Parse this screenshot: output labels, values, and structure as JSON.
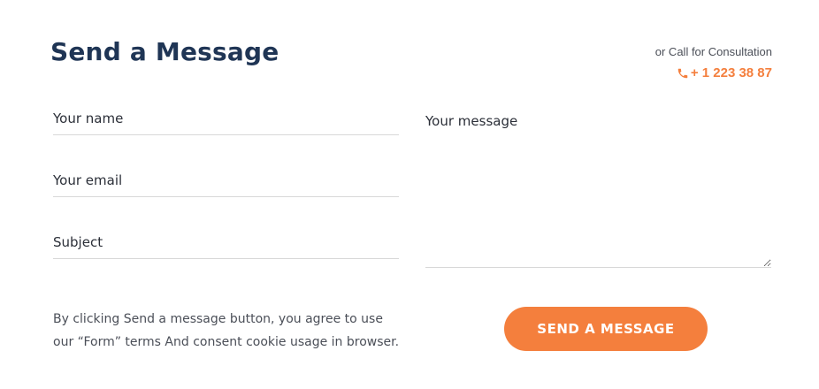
{
  "form": {
    "title": "Send a Message",
    "consult_text": "or Call for Consultation",
    "phone": "+ 1 223 38 87",
    "fields": {
      "name_placeholder": "Your name",
      "email_placeholder": "Your email",
      "subject_placeholder": "Subject",
      "message_placeholder": "Your message"
    },
    "consent_text": "By clicking Send a message button, you agree to use our “Form” terms And consent cookie usage in browser.",
    "send_label": "SEND A MESSAGE"
  },
  "colors": {
    "accent": "#f47f3d",
    "title": "#1f3555"
  },
  "icons": {
    "phone": "phone-icon"
  }
}
